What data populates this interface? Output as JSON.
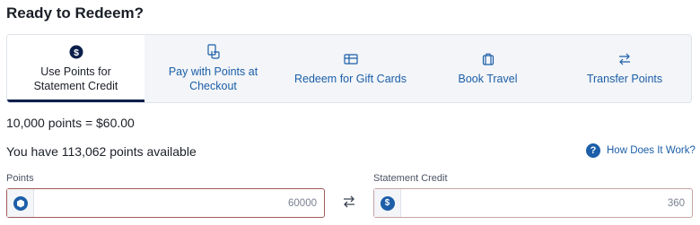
{
  "page_title": "Ready to Redeem?",
  "tabs": [
    {
      "label": "Use Points for\nStatement Credit",
      "icon": "dollar-circle-icon",
      "active": true
    },
    {
      "label": "Pay with Points at\nCheckout",
      "icon": "tap-pay-icon",
      "active": false
    },
    {
      "label": "Redeem for Gift Cards",
      "icon": "gift-card-icon",
      "active": false
    },
    {
      "label": "Book Travel",
      "icon": "luggage-icon",
      "active": false
    },
    {
      "label": "Transfer Points",
      "icon": "transfer-arrows-icon",
      "active": false
    }
  ],
  "conversion_rate": "10,000 points = $60.00",
  "points_available": "You have 113,062 points available",
  "help_link": "How Does It Work?",
  "points_field": {
    "label": "Points",
    "value": "60000"
  },
  "credit_field": {
    "label": "Statement Credit",
    "value": "360"
  },
  "colors": {
    "accent": "#1c5ea8",
    "active_tab_underline": "#0b1f4a",
    "field_border": "#a05a5a"
  }
}
